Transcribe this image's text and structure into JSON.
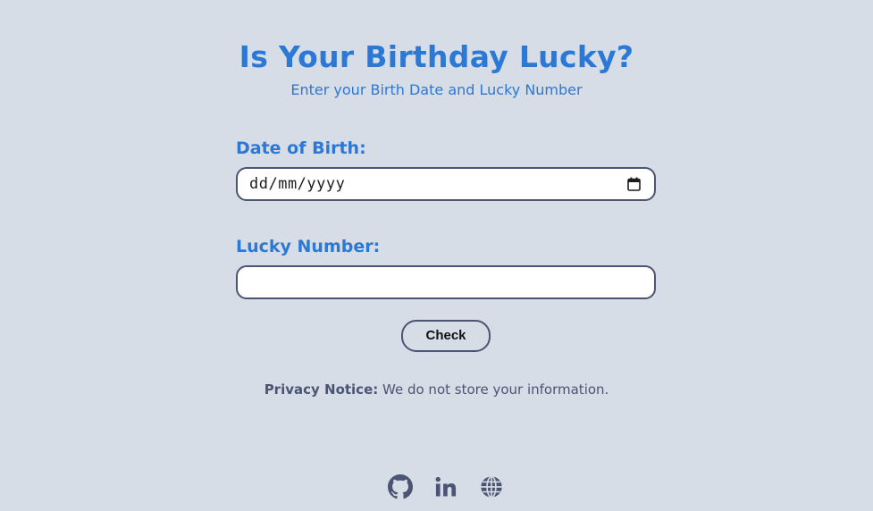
{
  "header": {
    "title": "Is Your Birthday Lucky?",
    "subtitle": "Enter your Birth Date and Lucky Number"
  },
  "form": {
    "dob": {
      "label": "Date of Birth:",
      "placeholder": "dd/mm/yyyy",
      "value": ""
    },
    "lucky": {
      "label": "Lucky Number:",
      "value": ""
    },
    "check_label": "Check"
  },
  "privacy": {
    "label": "Privacy Notice:",
    "text": " We do not store your information."
  },
  "footer": {
    "links": [
      {
        "icon": "github-icon"
      },
      {
        "icon": "linkedin-icon"
      },
      {
        "icon": "globe-icon"
      }
    ]
  },
  "colors": {
    "background": "#d6dde7",
    "accent": "#2b78d6",
    "border": "#4b5573"
  }
}
